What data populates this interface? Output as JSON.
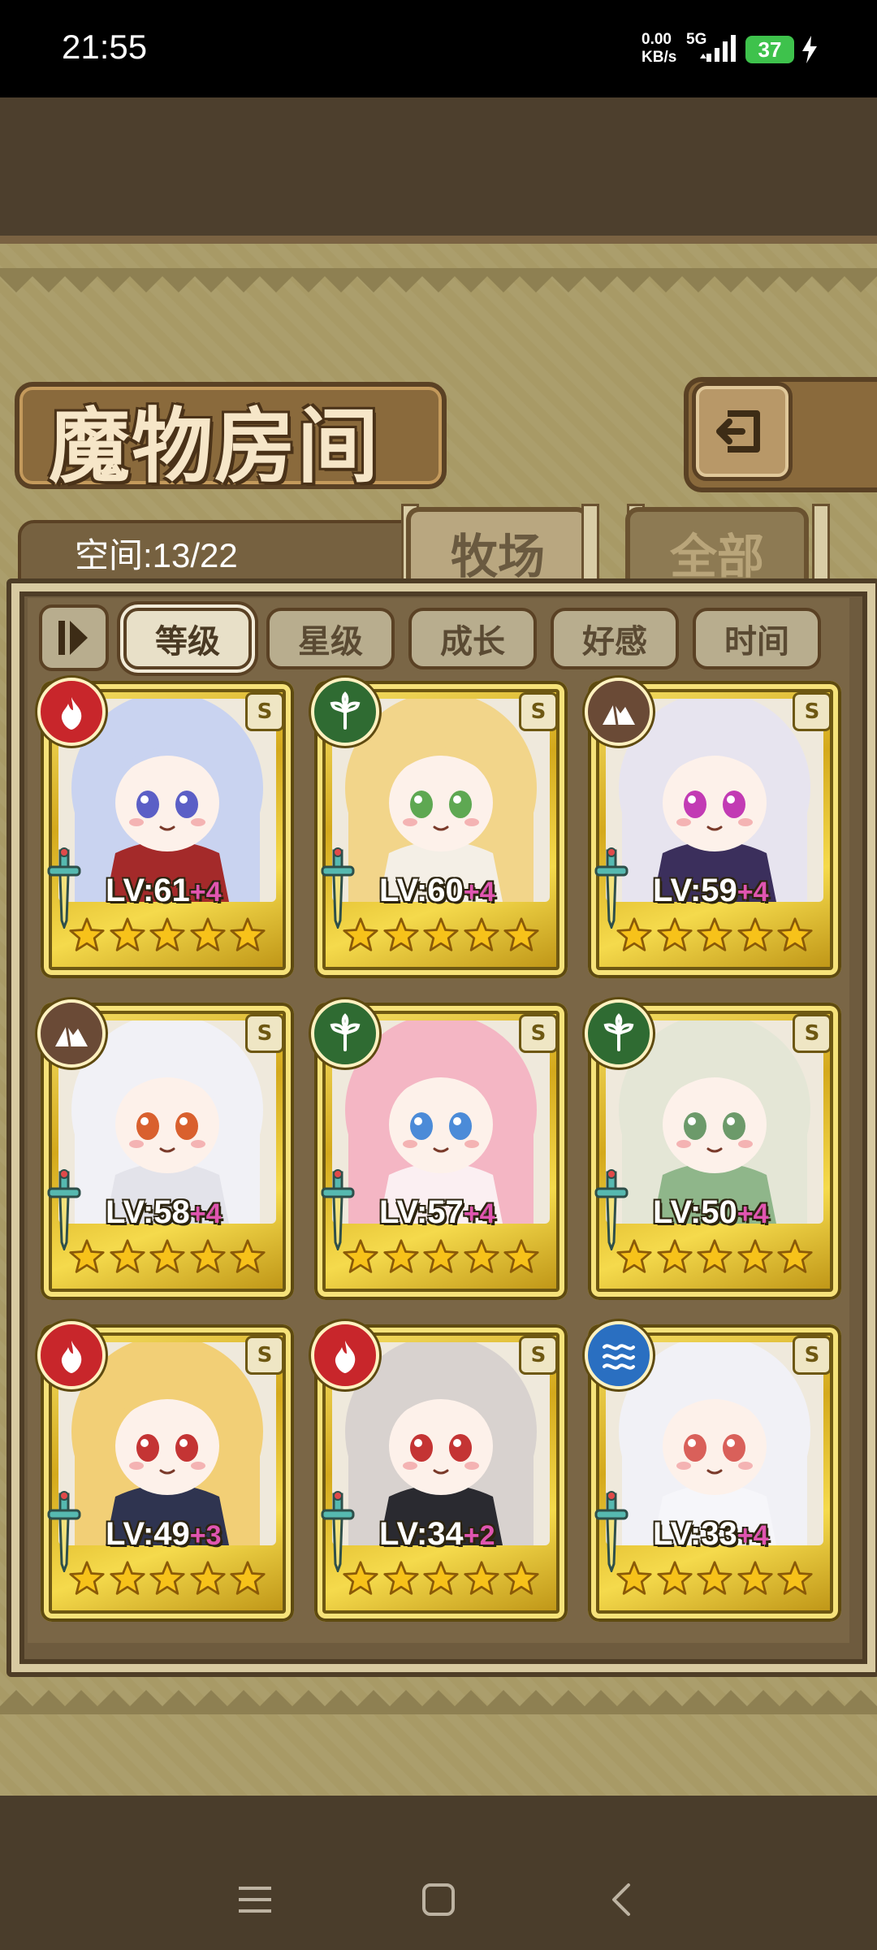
{
  "status_bar": {
    "time": "21:55",
    "net_speed_value": "0.00",
    "net_speed_unit": "KB/s",
    "network": "5G",
    "battery": "37"
  },
  "header": {
    "title": "魔物房间"
  },
  "storage": {
    "label": "空间:13/22"
  },
  "tabs": [
    {
      "label": "牧场",
      "active": true
    },
    {
      "label": "全部",
      "active": false
    }
  ],
  "sort_buttons": [
    {
      "label": "等级",
      "active": true
    },
    {
      "label": "星级",
      "active": false
    },
    {
      "label": "成长",
      "active": false
    },
    {
      "label": "好感",
      "active": false
    },
    {
      "label": "时间",
      "active": false
    }
  ],
  "monsters": [
    {
      "element": "fire",
      "level": "LV:61",
      "plus": "+4",
      "stars": 5,
      "rank": "S",
      "hair": "#c9d3f0",
      "eye": "#5b5fc6",
      "outfit": "#a42a2a"
    },
    {
      "element": "wood",
      "level": "LV:60",
      "plus": "+4",
      "stars": 5,
      "rank": "S",
      "hair": "#f2d58a",
      "eye": "#5ea852",
      "outfit": "#f4efe6"
    },
    {
      "element": "earth",
      "level": "LV:59",
      "plus": "+4",
      "stars": 5,
      "rank": "S",
      "hair": "#e7e4ef",
      "eye": "#c23bb4",
      "outfit": "#3b2f5c"
    },
    {
      "element": "earth",
      "level": "LV:58",
      "plus": "+4",
      "stars": 5,
      "rank": "S",
      "hair": "#f1f1f6",
      "eye": "#d9602e",
      "outfit": "#e3e3ea"
    },
    {
      "element": "wood",
      "level": "LV:57",
      "plus": "+4",
      "stars": 5,
      "rank": "S",
      "hair": "#f4b6c4",
      "eye": "#4b8bd8",
      "outfit": "#fbeff2"
    },
    {
      "element": "wood",
      "level": "LV:50",
      "plus": "+4",
      "stars": 5,
      "rank": "S",
      "hair": "#e4e6d6",
      "eye": "#6c9a6a",
      "outfit": "#8fb68a"
    },
    {
      "element": "fire",
      "level": "LV:49",
      "plus": "+3",
      "stars": 5,
      "rank": "S",
      "hair": "#f2cf76",
      "eye": "#c43434",
      "outfit": "#2f3450"
    },
    {
      "element": "fire",
      "level": "LV:34",
      "plus": "+2",
      "stars": 5,
      "rank": "S",
      "hair": "#d8d2cf",
      "eye": "#c43434",
      "outfit": "#2a2a30"
    },
    {
      "element": "water",
      "level": "LV:33",
      "plus": "+4",
      "stars": 5,
      "rank": "S",
      "hair": "#f1f1f6",
      "eye": "#d9605a",
      "outfit": "#f6f6fa"
    }
  ],
  "colors": {
    "fire": "#c8262b",
    "wood": "#2f6b32",
    "earth": "#6a4a36",
    "water": "#2a6fc1"
  }
}
